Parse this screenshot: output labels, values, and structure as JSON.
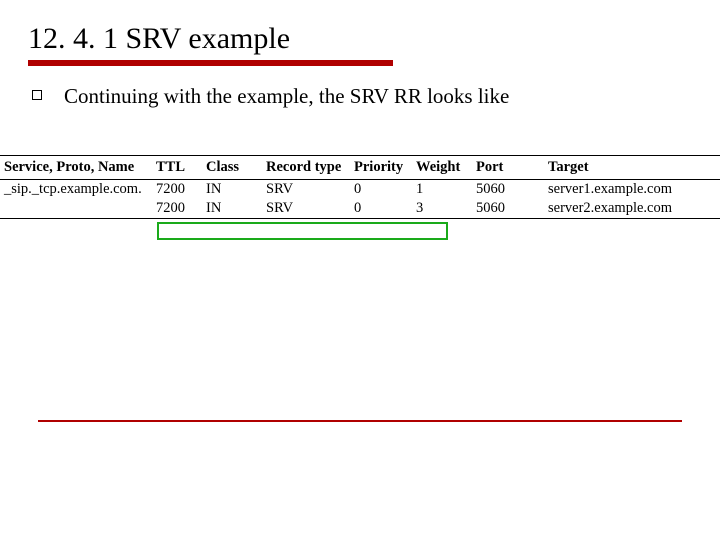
{
  "title": "12. 4. 1 SRV example",
  "bullet": "Continuing with the example, the SRV RR looks like",
  "headers": {
    "name": "Service, Proto, Name",
    "ttl": "TTL",
    "class": "Class",
    "rtype": "Record type",
    "priority": "Priority",
    "weight": "Weight",
    "port": "Port",
    "target": "Target"
  },
  "rows": [
    {
      "name": "_sip._tcp.example.com.",
      "ttl": "7200",
      "class": "IN",
      "rtype": "SRV",
      "priority": "0",
      "weight": "1",
      "port": "5060",
      "target": "server1.example.com"
    },
    {
      "name": "",
      "ttl": "7200",
      "class": "IN",
      "rtype": "SRV",
      "priority": "0",
      "weight": "3",
      "port": "5060",
      "target": "server2.example.com"
    }
  ]
}
